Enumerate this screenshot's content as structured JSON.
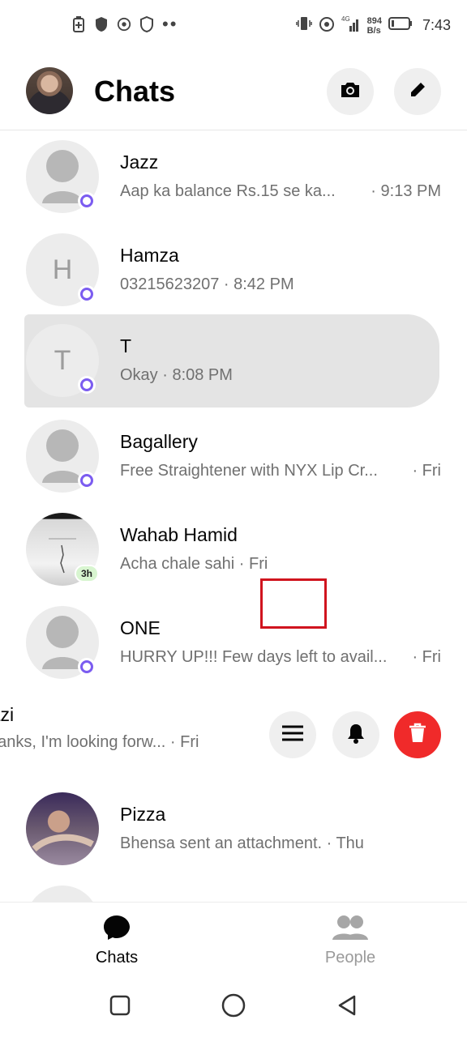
{
  "status_bar": {
    "net_speed_value": "894",
    "net_speed_unit": "B/s",
    "network_type": "4G",
    "time": "7:43"
  },
  "header": {
    "title": "Chats"
  },
  "chats": [
    {
      "name": "Jazz",
      "snippet": "Aap ka balance Rs.15 se ka...",
      "time": "· 9:13 PM",
      "avatar": "person-placeholder",
      "badge": "messenger"
    },
    {
      "name": "Hamza",
      "snippet": "03215623207 · 8:42 PM",
      "time": "",
      "avatar_letter": "H",
      "badge": "messenger"
    },
    {
      "name": "T",
      "snippet": "Okay · 8:08 PM",
      "time": "",
      "avatar_letter": "T",
      "badge": "messenger",
      "highlighted": true
    },
    {
      "name": "Bagallery",
      "snippet": "Free Straightener with NYX Lip Cr...",
      "time": "· Fri",
      "avatar": "person-placeholder",
      "badge": "messenger"
    },
    {
      "name": "Wahab Hamid",
      "snippet": "Acha chale sahi · Fri",
      "time": "",
      "avatar": "photo",
      "active_badge": "3h"
    },
    {
      "name": "ONE",
      "snippet": "HURRY UP!!! Few days left to avail...",
      "time": "· Fri",
      "avatar": "person-placeholder",
      "badge": "messenger"
    },
    {
      "name": "razi",
      "snippet": "hanks, I'm looking forw... · Fri",
      "time": "",
      "swiped": true
    },
    {
      "name": "Pizza",
      "snippet": "Bhensa sent an attachment. · Thu",
      "time": "",
      "avatar": "photo"
    }
  ],
  "swipe_actions": {
    "more": "menu-icon",
    "mute": "bell-icon",
    "delete": "trash-icon"
  },
  "bottom_nav": {
    "chats_label": "Chats",
    "people_label": "People"
  },
  "colors": {
    "messenger_badge": "#7b5cf0",
    "delete_red": "#f02a2a",
    "highlight_box": "#d0141e"
  }
}
